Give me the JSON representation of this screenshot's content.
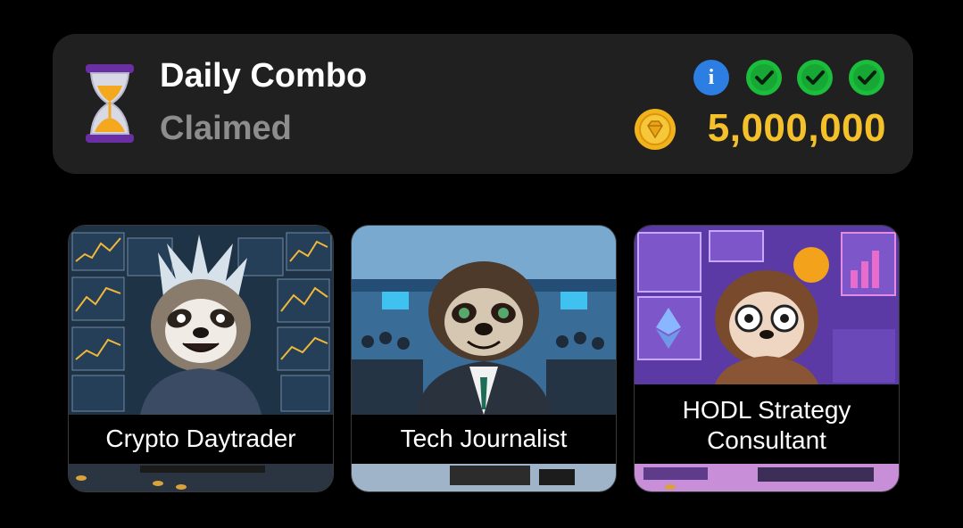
{
  "combo": {
    "title": "Daily Combo",
    "status": "Claimed",
    "reward": "5,000,000",
    "icon": "hourglass-icon",
    "info_badge": "i",
    "checks_completed": 3,
    "colors": {
      "reward": "#f4c12b",
      "check": "#1bbd3c",
      "info": "#2d7ee3"
    }
  },
  "cards": [
    {
      "label": "Crypto Daytrader"
    },
    {
      "label": "Tech Journalist"
    },
    {
      "label": "HODL Strategy Consultant"
    }
  ]
}
